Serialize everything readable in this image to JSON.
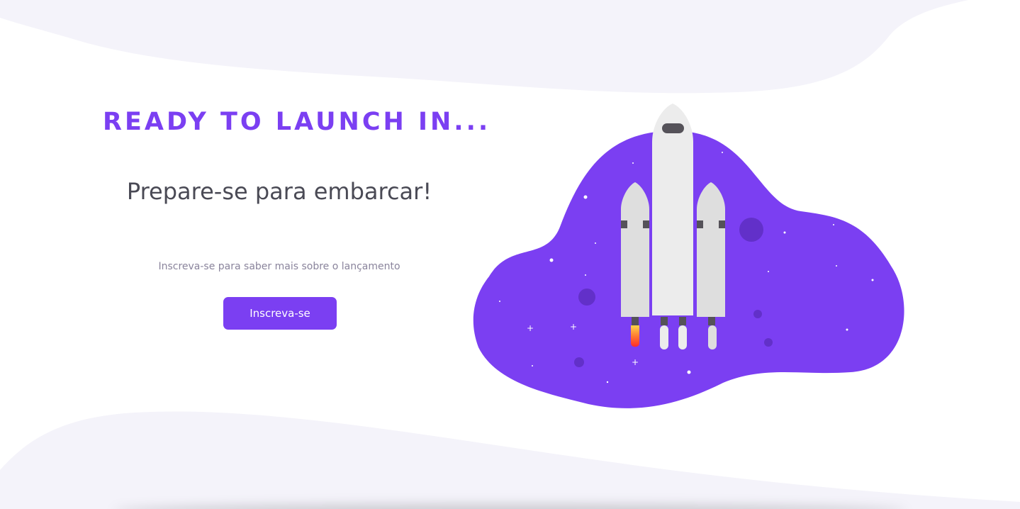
{
  "hero": {
    "headline": "READY TO LAUNCH IN...",
    "subtitle": "Prepare-se para embarcar!",
    "caption": "Inscreva-se para saber mais sobre o lançamento",
    "cta_label": "Inscreva-se"
  },
  "colors": {
    "accent": "#7b3ff2",
    "heading_text": "#4a4a55",
    "caption_text": "#8a849c",
    "wave_fill": "#f4f3fa",
    "rocket_body": "#ececec",
    "booster_body": "#dedede",
    "rocket_dark": "#555259",
    "planet_dark": "#6230c9"
  },
  "illustration": {
    "icon": "rocket-launch-illustration"
  }
}
